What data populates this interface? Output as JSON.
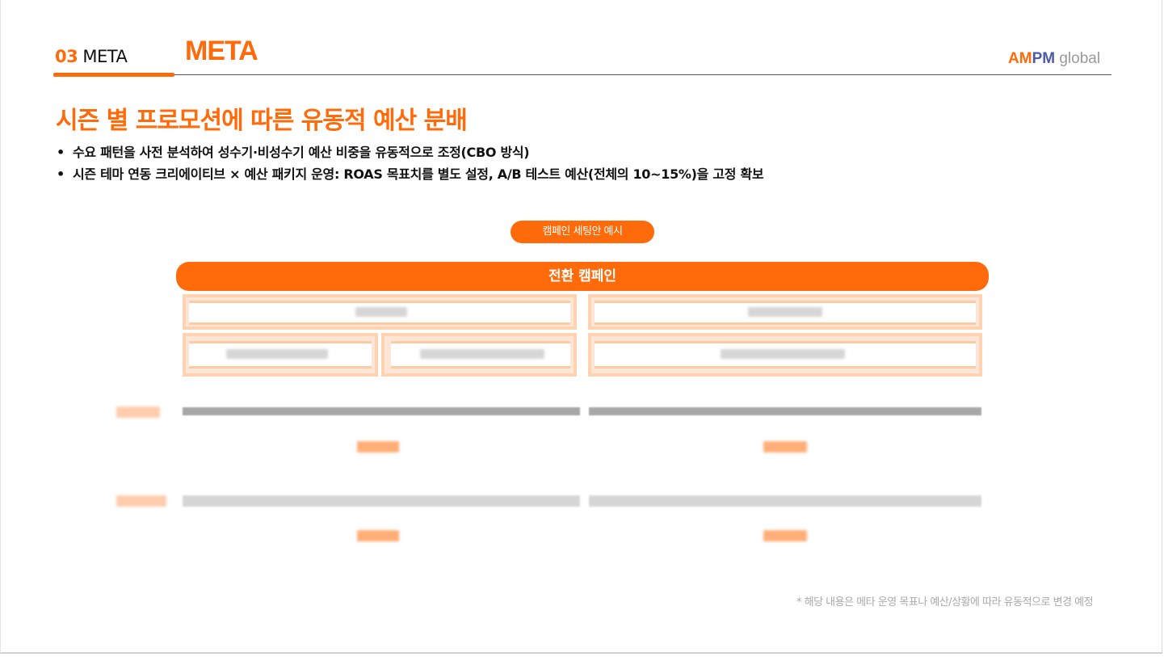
{
  "header": {
    "section_number": "03",
    "section_name": "META",
    "title": "META",
    "logo_am": "AM",
    "logo_pm": "PM",
    "logo_global": "global"
  },
  "heading": "시즌 별 프로모션에 따른 유동적 예산 분배",
  "bullets": [
    "수요 패턴을 사전 분석하여 성수기·비성수기 예산 비중을 유동적으로 조정(CBO 방식)",
    "시즌 테마 연동 크리에이티브 × 예산 패키지 운영: ROAS 목표치를 별도 설정, A/B 테스트 예산(전체의 10~15%)을 고정 확보"
  ],
  "example_pill": "캠페인 세팅안 예시",
  "campaign_bar": "전환 캠페인",
  "footnote": "* 해당 내용은 메타 운영 목표나 예산/상황에 따라 유동적으로 변경 예정",
  "colors": {
    "accent": "#ff6b0a",
    "logo_blue": "#4b5aa8",
    "muted": "#a9a9a9"
  }
}
